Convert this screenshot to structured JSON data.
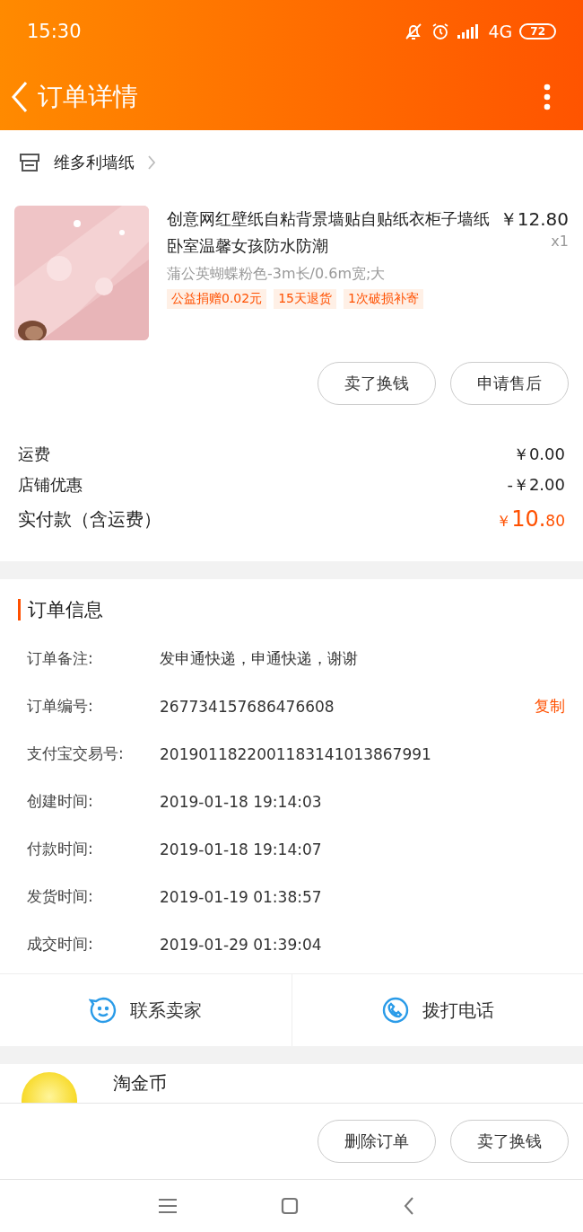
{
  "status_bar": {
    "time": "15:30",
    "network": "4G",
    "battery": "72"
  },
  "header": {
    "title": "订单详情"
  },
  "shop": {
    "name": "维多利墙纸"
  },
  "product": {
    "kind": "picture",
    "title": "创意网红壁纸自粘背景墙贴自贴纸衣柜子墙纸卧室温馨女孩防水防潮",
    "price": "￥12.80",
    "quantity": "x1",
    "sku": "蒲公英蝴蝶粉色-3m长/0.6m宽;大",
    "tags": [
      "公益捐赠0.02元",
      "15天退货",
      "1次破损补寄"
    ],
    "buttons": [
      "卖了换钱",
      "申请售后"
    ]
  },
  "fees": [
    {
      "label": "运费",
      "value": "￥0.00",
      "kind": "plain"
    },
    {
      "label": "店铺优惠",
      "value": "-￥2.00",
      "kind": "plain"
    },
    {
      "label": "实付款（含运费）",
      "kind": "total",
      "currency": "￥",
      "integer": "10.",
      "decimal": "80"
    }
  ],
  "order_info": {
    "title": "订单信息",
    "rows": [
      {
        "label": "订单备注:",
        "value": "发申通快递，申通快递，谢谢"
      },
      {
        "label": "订单编号:",
        "value": "267734157686476608",
        "action": "复制"
      },
      {
        "label": "支付宝交易号:",
        "value": "2019011822001183141013867991"
      },
      {
        "label": "创建时间:",
        "value": "2019-01-18 19:14:03"
      },
      {
        "label": "付款时间:",
        "value": "2019-01-18 19:14:07"
      },
      {
        "label": "发货时间:",
        "value": "2019-01-19 01:38:57"
      },
      {
        "label": "成交时间:",
        "value": "2019-01-29 01:39:04"
      }
    ]
  },
  "contact": [
    {
      "label": "联系卖家",
      "kind": "chat"
    },
    {
      "label": "拨打电话",
      "kind": "phone"
    }
  ],
  "coins": {
    "title": "淘金币"
  },
  "footer": {
    "buttons": [
      "删除订单",
      "卖了换钱"
    ]
  }
}
